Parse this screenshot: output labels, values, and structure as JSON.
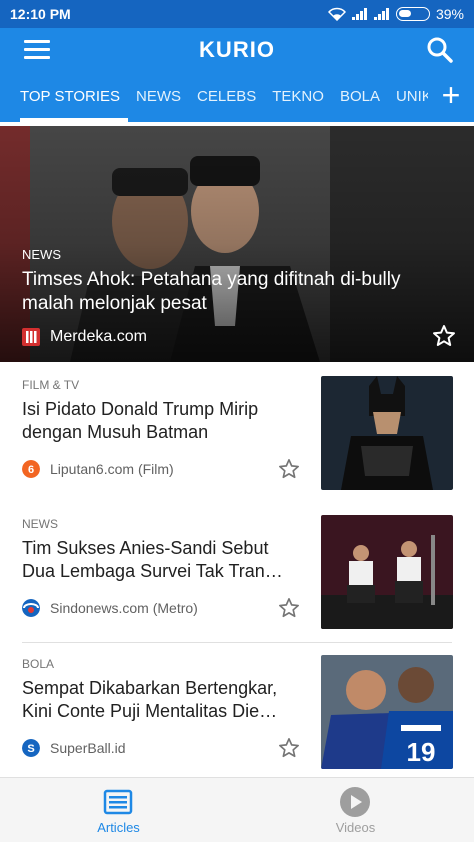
{
  "status_bar": {
    "time": "12:10 PM",
    "battery": "39%"
  },
  "appbar": {
    "title": "KURIO",
    "menu_icon": "hamburger-icon",
    "search_icon": "search-icon"
  },
  "tabs": [
    {
      "label": "TOP STORIES",
      "active": true
    },
    {
      "label": "NEWS"
    },
    {
      "label": "CELEBS"
    },
    {
      "label": "TEKNO"
    },
    {
      "label": "BOLA"
    },
    {
      "label": "UNIK"
    }
  ],
  "tab_add": "+",
  "hero": {
    "category": "NEWS",
    "title": "Timses Ahok: Petahana yang difitnah di-bully malah melonjak pesat",
    "source": "Merdeka.com"
  },
  "articles": [
    {
      "category": "FILM & TV",
      "title": "Isi Pidato Donald Trump Mirip dengan Musuh Batman",
      "source": "Liputan6.com (Film)"
    },
    {
      "category": "NEWS",
      "title": "Tim Sukses Anies-Sandi Sebut Dua Lembaga Survei Tak Tran…",
      "source": "Sindonews.com (Metro)"
    },
    {
      "category": "BOLA",
      "title": "Sempat Dikabarkan Bertengkar, Kini Conte Puji Mentalitas Die…",
      "source": "SuperBall.id"
    }
  ],
  "bottom_nav": [
    {
      "label": "Articles",
      "active": true
    },
    {
      "label": "Videos"
    }
  ],
  "colors": {
    "primary": "#1e88e5",
    "status_bar": "#1565c0",
    "accent_inactive": "#9e9e9e"
  }
}
